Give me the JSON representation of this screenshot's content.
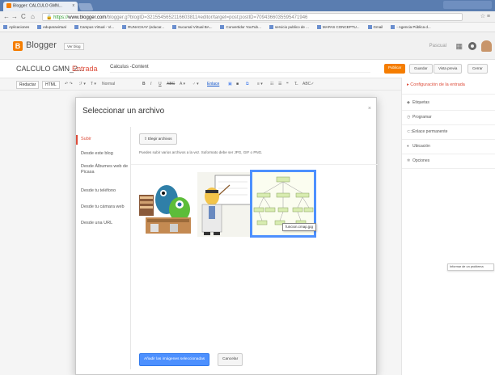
{
  "browser": {
    "tab_title": "Blogger: CALCULO GMN...",
    "tab_close": "x",
    "url_scheme": "https://",
    "url_host": "www.blogger.com",
    "url_path": "/blogger.g?blogID=3215545652116603811#editor/target=post;postID=7094366035595471946",
    "back": "←",
    "forward": "→",
    "reload": "C",
    "home": "⌂",
    "extensions": "☆ ≡"
  },
  "bookmarks": [
    "Aplicaciones",
    "eduparavirtual",
    "Campus Virtual - Vi...",
    "RUNACHAY (educar...",
    "Sucursal Virtual BA...",
    "Convertidor YouTub...",
    "servicio publico de ...",
    "MAPAS CONCEPTU...",
    "Gmail",
    "- Agencia Pública d..."
  ],
  "blogger": {
    "logo_letter": "B",
    "name": "Blogger",
    "view_blog": "Ver blog",
    "user": "Pascual",
    "grid_icon": "▦"
  },
  "post": {
    "blog_title": "CALCULO GMN_2...",
    "separator": "·",
    "entry_label": "Entrada",
    "title_value": "Calculus -Content",
    "publish": "Publicar",
    "save": "Guardar",
    "preview": "Vista previa",
    "close": "Cerrar"
  },
  "toolbar": {
    "compose": "Redactar",
    "html": "HTML",
    "undo_redo": "↶ ↷",
    "font": "ℱ ▾",
    "size": "T ▾",
    "format": "Normal",
    "bold": "B",
    "italic": "I",
    "underline": "U",
    "strike": "ABC",
    "textcolor": "A ▾",
    "highlight": "♂ ▾",
    "link": "Enlace",
    "align": "≡ ▾",
    "numlist": "☷",
    "bullist": "☰",
    "quote": "❝",
    "clearfmt": "T̶",
    "spell": "ABC✓"
  },
  "sidebar": {
    "header": "Configuración de la entrada",
    "items": [
      {
        "icon": "◆",
        "label": "Etiquetas"
      },
      {
        "icon": "◷",
        "label": "Programar"
      },
      {
        "icon": "⊂⊃",
        "label": "Enlace permanente"
      },
      {
        "icon": "♦",
        "label": "Ubicación"
      },
      {
        "icon": "✲",
        "label": "Opciones"
      }
    ],
    "report": "Informar de un problema"
  },
  "dialog": {
    "title": "Seleccionar un archivo",
    "close": "×",
    "nav": [
      "Subir",
      "Desde este blog",
      "Desde Álbumes web de Picasa",
      "Desde tu teléfono",
      "Desde tu cámara web",
      "Desde una URL"
    ],
    "upload_button": "Elegir archivos",
    "upload_hint": "Puedes subir varios archivos a la vez. Suformato debe ser JPG, GIF o PNG.",
    "tooltip": "funcion.cmap.jpg",
    "add_button": "Añadir las imágenes seleccionadas",
    "cancel_button": "Cancelar"
  }
}
